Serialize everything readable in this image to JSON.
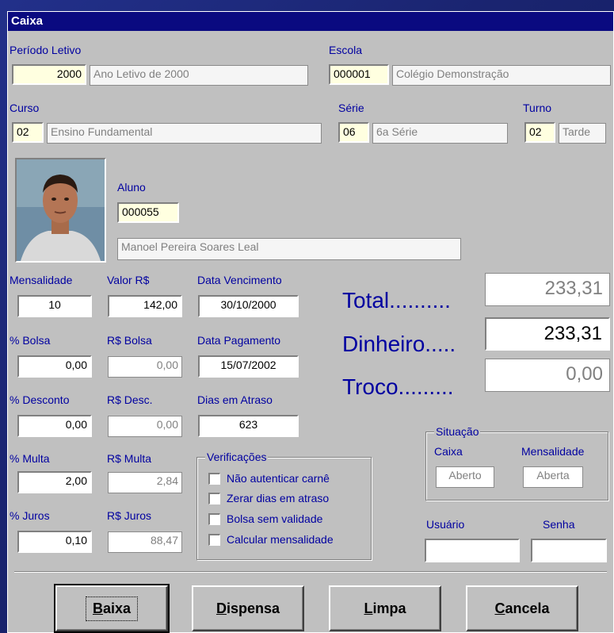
{
  "window": {
    "title": "Caixa"
  },
  "periodo": {
    "label": "Período Letivo",
    "code": "2000",
    "desc": "Ano Letivo de 2000"
  },
  "escola": {
    "label": "Escola",
    "code": "000001",
    "desc": "Colégio Demonstração"
  },
  "curso": {
    "label": "Curso",
    "code": "02",
    "desc": "Ensino Fundamental"
  },
  "serie": {
    "label": "Série",
    "code": "06",
    "desc": "6a Série"
  },
  "turno": {
    "label": "Turno",
    "code": "02",
    "desc": "Tarde"
  },
  "aluno": {
    "label": "Aluno",
    "code": "000055",
    "name": "Manoel Pereira Soares Leal"
  },
  "payment": {
    "mensalidade": {
      "label": "Mensalidade",
      "value": "10"
    },
    "valor": {
      "label": "Valor R$",
      "value": "142,00"
    },
    "data_vencimento": {
      "label": "Data Vencimento",
      "value": "30/10/2000"
    },
    "pct_bolsa": {
      "label": "% Bolsa",
      "value": "0,00"
    },
    "rs_bolsa": {
      "label": "R$ Bolsa",
      "value": "0,00"
    },
    "data_pagamento": {
      "label": "Data Pagamento",
      "value": "15/07/2002"
    },
    "pct_desconto": {
      "label": "% Desconto",
      "value": "0,00"
    },
    "rs_desc": {
      "label": "R$ Desc.",
      "value": "0,00"
    },
    "dias_atraso": {
      "label": "Dias em Atraso",
      "value": "623"
    },
    "pct_multa": {
      "label": "% Multa",
      "value": "2,00"
    },
    "rs_multa": {
      "label": "R$ Multa",
      "value": "2,84"
    },
    "pct_juros": {
      "label": "% Juros",
      "value": "0,10"
    },
    "rs_juros": {
      "label": "R$ Juros",
      "value": "88,47"
    }
  },
  "totals": {
    "total": {
      "label": "Total..........",
      "value": "233,31"
    },
    "dinheiro": {
      "label": "Dinheiro.....",
      "value": "233,31"
    },
    "troco": {
      "label": "Troco.........",
      "value": "0,00"
    }
  },
  "verificacoes": {
    "title": "Verificações",
    "items": [
      {
        "label": "Não autenticar carnê",
        "checked": false
      },
      {
        "label": "Zerar dias em atraso",
        "checked": false
      },
      {
        "label": "Bolsa sem validade",
        "checked": false
      },
      {
        "label": "Calcular mensalidade",
        "checked": false
      }
    ]
  },
  "situacao": {
    "title": "Situação",
    "caixa_label": "Caixa",
    "caixa_value": "Aberto",
    "mensalidade_label": "Mensalidade",
    "mensalidade_value": "Aberta"
  },
  "login": {
    "usuario_label": "Usuário",
    "usuario_value": "",
    "senha_label": "Senha",
    "senha_value": ""
  },
  "buttons": {
    "baixa": {
      "u": "B",
      "rest": "aixa"
    },
    "dispensa": {
      "u": "D",
      "rest": "ispensa"
    },
    "limpa": {
      "u": "L",
      "rest": "impa"
    },
    "cancela": {
      "u": "C",
      "rest": "ancela"
    }
  },
  "colors": {
    "title_bar": "#0a0a80",
    "label_blue": "#0000a0",
    "window_bg": "#c0c0c0",
    "field_yellow": "#ffffe0"
  }
}
